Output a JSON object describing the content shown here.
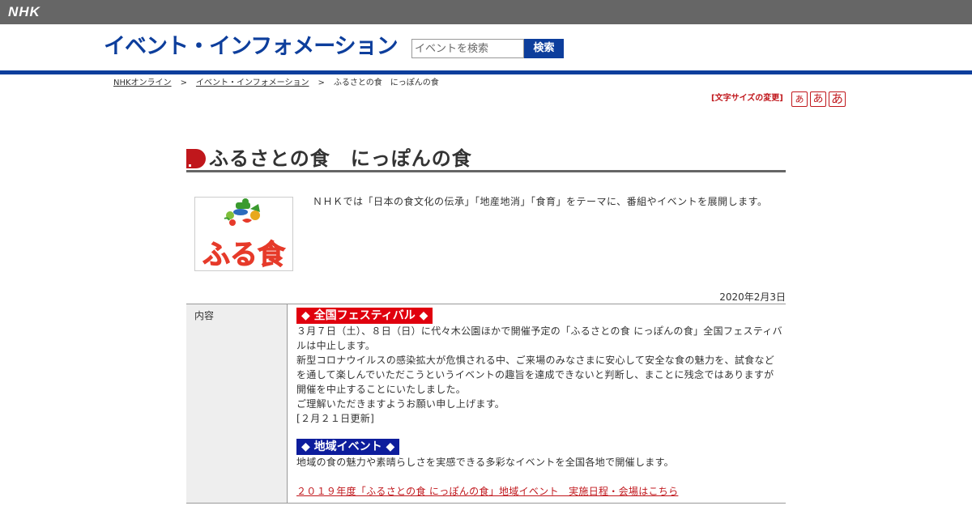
{
  "topbar": {
    "logo_text": "NHK",
    "background": "#666666"
  },
  "header": {
    "title": "イベント・インフォメーション",
    "search_placeholder": "イベントを検索",
    "search_button": "検索",
    "accent_color": "#0d3e9c"
  },
  "breadcrumb": {
    "items": [
      "NHKオンライン",
      "イベント・インフォメーション",
      "ふるさとの食　にっぽんの食"
    ],
    "separator": ">"
  },
  "font_size": {
    "label": "[文字サイズの変更]",
    "small": "あ",
    "medium": "あ",
    "large": "あ",
    "color": "#c0171c"
  },
  "page": {
    "title": "ふるさとの食　にっぽんの食",
    "logo_text": "ふる食",
    "intro": "ＮＨＫでは「日本の食文化の伝承」「地産地消」「食育」をテーマに、番組やイベントを展開します。",
    "date": "2020年2月3日"
  },
  "content": {
    "label": "内容",
    "festival_banner": "◆ 全国フェスティバル ◆",
    "festival_p1": "３月７日（土）、８日（日）に代々木公園ほかで開催予定の「ふるさとの食 にっぽんの食」全国フェスティバルは中止します。",
    "festival_p2": "新型コロナウイルスの感染拡大が危惧される中、ご来場のみなさまに安心して安全な食の魅力を、試食などを通して楽しんでいただこうというイベントの趣旨を達成できないと判断し、まことに残念ではありますが開催を中止することにいたしました。",
    "festival_p3": "ご理解いただきますようお願い申し上げます。",
    "festival_updated": "[２月２１日更新]",
    "regional_banner": "◆ 地域イベント ◆",
    "regional_text": "地域の食の魅力や素晴らしさを実感できる多彩なイベントを全国各地で開催します。",
    "regional_link": "２０１９年度「ふるさとの食 にっぽんの食」地域イベント　実施日程・会場はこちら",
    "festival_color": "#e0000e",
    "regional_color": "#0d1d9c"
  }
}
